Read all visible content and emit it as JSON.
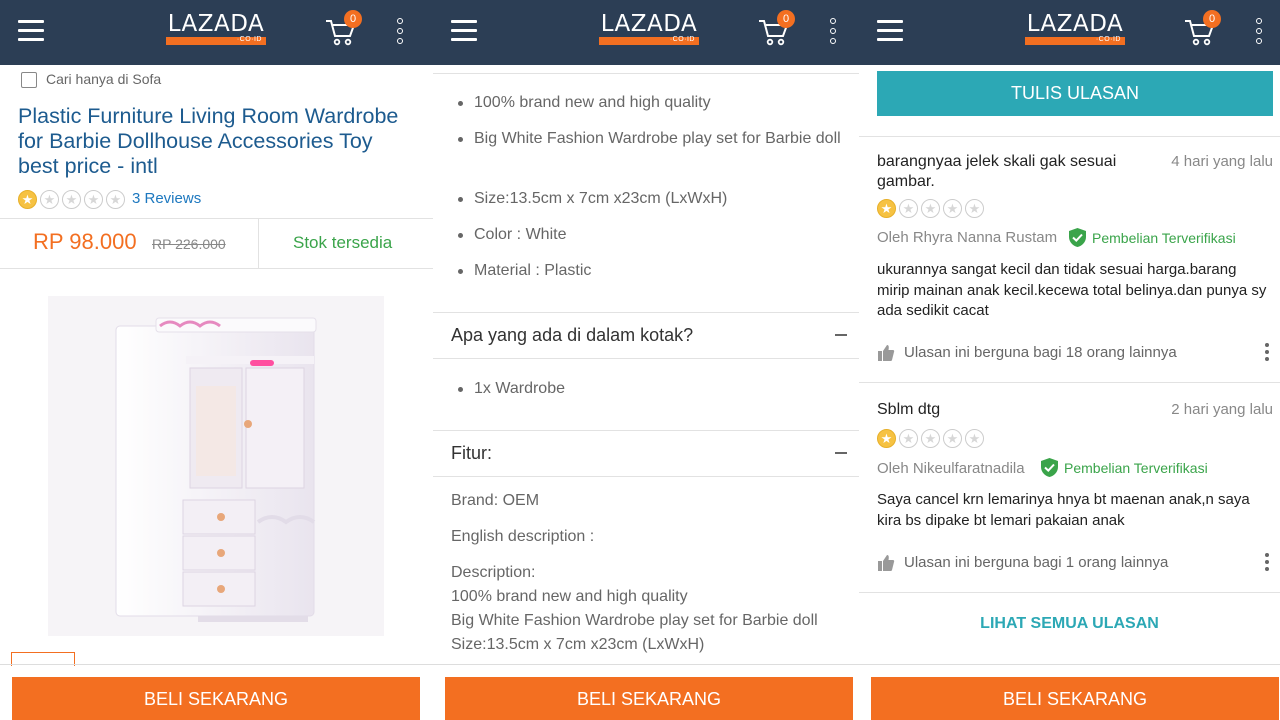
{
  "header": {
    "logo_text": "LAZADA",
    "logo_sub": "·CO·ID",
    "cart_count": "0",
    "icons": [
      "hamburger-menu-icon",
      "cart-icon",
      "more-vertical-icon"
    ]
  },
  "colors": {
    "header_bg": "#2c3e55",
    "accent_orange": "#f36f21",
    "teal": "#2ca8b5",
    "green": "#3aa44a",
    "link_blue": "#1d78bf"
  },
  "buy_label": "BELI SEKARANG",
  "panel1": {
    "search_only_label": "Cari hanya di Sofa",
    "product_title": "Plastic Furniture Living Room Wardrobe for Barbie Dollhouse Accessories Toy best price - intl",
    "rating": 1,
    "rating_max": 5,
    "reviews_link": "3 Reviews",
    "price": "RP 98.000",
    "old_price": "RP 226.000",
    "stock": "Stok tersedia"
  },
  "panel2": {
    "highlights": [
      "100% brand new and high quality",
      "Big White Fashion Wardrobe play set for Barbie doll",
      "Size:13.5cm x 7cm x23cm (LxWxH)",
      "Color : White",
      "Material : Plastic"
    ],
    "box_title": "Apa yang ada di dalam kotak?",
    "box_items": [
      "1x Wardrobe"
    ],
    "features_title": "Fitur:",
    "brand": "Brand: OEM",
    "english_desc": "English description :",
    "desc_label": "Description:",
    "desc_lines": [
      "100% brand new and high quality",
      "Big White Fashion Wardrobe play set for Barbie doll",
      "Size:13.5cm x 7cm x23cm  (LxWxH)"
    ]
  },
  "panel3": {
    "write_review": "TULIS ULASAN",
    "verified_label": "Pembelian Terverifikasi",
    "reviews": [
      {
        "title": "barangnyaa jelek skali gak sesuai gambar.",
        "date": "4 hari yang lalu",
        "rating": 1,
        "author": "Oleh Rhyra Nanna Rustam",
        "body": "ukurannya sangat kecil dan tidak sesuai harga.barang mirip mainan anak kecil.kecewa total belinya.dan punya sy ada sedikit cacat",
        "helpful": "Ulasan ini berguna bagi 18 orang lainnya"
      },
      {
        "title": "Sblm dtg",
        "date": "2 hari yang lalu",
        "rating": 1,
        "author": "Oleh Nikeulfaratnadila",
        "body": "Saya cancel krn lemarinya hnya bt maenan anak,n saya kira bs dipake bt lemari pakaian anak",
        "helpful": "Ulasan ini berguna bagi 1 orang lainnya"
      }
    ],
    "see_all": "LIHAT SEMUA ULASAN"
  }
}
